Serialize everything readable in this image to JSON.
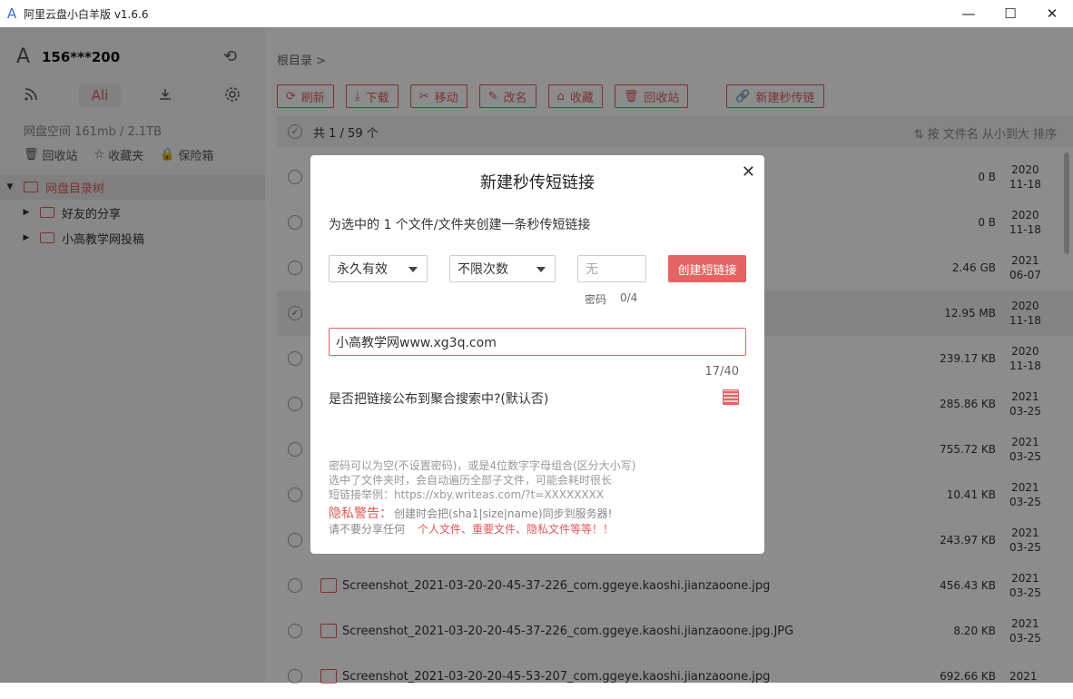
{
  "window": {
    "title": "阿里云盘小白羊版 v1.6.6",
    "logo": "A",
    "minimize": "—",
    "maximize": "☐",
    "close": "✕"
  },
  "account": {
    "name": "156***200"
  },
  "sidebar": {
    "tab_ali": "Ali",
    "space": "网盘空间 161mb / 2.1TB",
    "quick": [
      {
        "label": "回收站",
        "icon": "trash-icon"
      },
      {
        "label": "收藏夹",
        "icon": "star-icon"
      },
      {
        "label": "保险箱",
        "icon": "lock-icon"
      }
    ],
    "tree": [
      {
        "label": "网盘目录树",
        "expanded": true
      },
      {
        "label": "好友的分享"
      },
      {
        "label": "小高教学网投稿"
      }
    ]
  },
  "main": {
    "breadcrumb": "根目录 >",
    "toolbar": [
      "刷新",
      "下载",
      "移动",
      "改名",
      "收藏",
      "回收站",
      "新建秒传链"
    ],
    "count": "共 1 / 59 个",
    "sort": "按 文件名 从小到大 排序",
    "rows": [
      {
        "name": "",
        "size": "0 B",
        "date1": "2020",
        "date2": "11-18",
        "selected": false
      },
      {
        "name": "",
        "size": "0 B",
        "date1": "2020",
        "date2": "11-18",
        "selected": false
      },
      {
        "name": "",
        "size": "2.46 GB",
        "date1": "2021",
        "date2": "06-07",
        "selected": false
      },
      {
        "name": "",
        "size": "12.95 MB",
        "date1": "2020",
        "date2": "11-18",
        "selected": true
      },
      {
        "name": "",
        "size": "239.17 KB",
        "date1": "2020",
        "date2": "11-18",
        "selected": false
      },
      {
        "name": "",
        "size": "285.86 KB",
        "date1": "2021",
        "date2": "03-25",
        "selected": false
      },
      {
        "name": "",
        "size": "755.72 KB",
        "date1": "2021",
        "date2": "03-25",
        "selected": false
      },
      {
        "name": "",
        "size": "10.41 KB",
        "date1": "2021",
        "date2": "03-25",
        "selected": false
      },
      {
        "name": "",
        "size": "243.97 KB",
        "date1": "2021",
        "date2": "03-25",
        "selected": false
      },
      {
        "name": "Screenshot_2021-03-20-20-45-37-226_com.ggeye.kaoshi.jianzaoone.jpg",
        "size": "456.43 KB",
        "date1": "2021",
        "date2": "03-25",
        "selected": false
      },
      {
        "name": "Screenshot_2021-03-20-20-45-37-226_com.ggeye.kaoshi.jianzaoone.jpg.JPG",
        "size": "8.20 KB",
        "date1": "2021",
        "date2": "03-25",
        "selected": false
      },
      {
        "name": "Screenshot_2021-03-20-20-45-53-207_com.ggeye.kaoshi.jianzaoone.jpg",
        "size": "692.66 KB",
        "date1": "2021",
        "date2": "",
        "selected": false
      }
    ]
  },
  "dialog": {
    "title": "新建秒传短链接",
    "desc": "为选中的 1 个文件/文件夹创建一条秒传短链接",
    "expire": "永久有效",
    "times": "不限次数",
    "pwd_placeholder": "无",
    "pwd_label": "密码",
    "pwd_count": "0/4",
    "create": "创建短链接",
    "link_title": "小高教学网www.xg3q.com",
    "title_count": "17/40",
    "publish_q": "是否把链接公布到聚合搜索中?(默认否)",
    "note1": "密码可以为空(不设置密码)，或是4位数字字母组合(区分大小写)",
    "note2": "选中了文件夹时，会自动遍历全部子文件，可能会耗时很长",
    "note3": "短链接举例：https://xby.writeas.com/?t=XXXXXXXX",
    "warn_label": "隐私警告：",
    "warn_text": "创建时会把(sha1|size|name)同步到服务器!",
    "warn2": "请不要分享任何",
    "warn2_red": "个人文件、重要文件、隐私文件等等！！"
  }
}
